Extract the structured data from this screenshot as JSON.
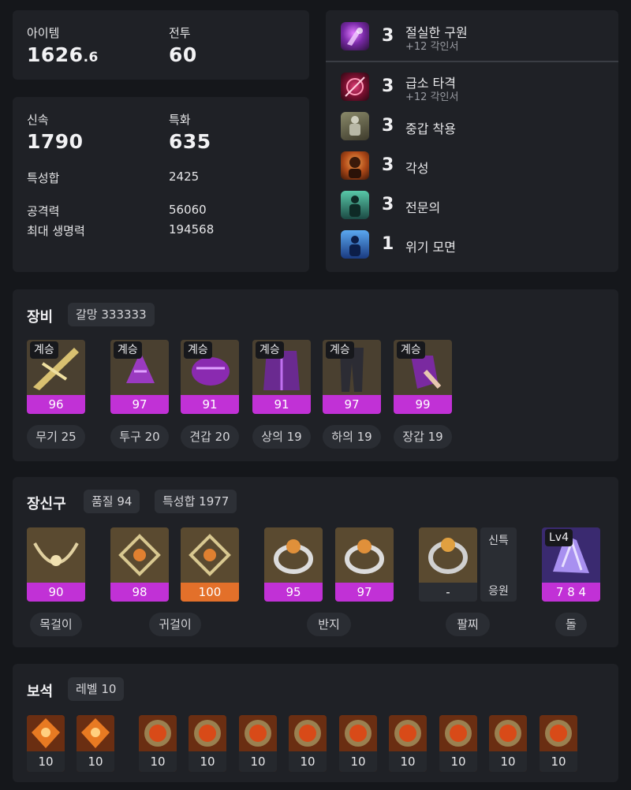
{
  "stats_top": {
    "item_label": "아이템",
    "item_value_main": "1626",
    "item_value_dec": ".6",
    "combat_label": "전투",
    "combat_value": "60"
  },
  "stats_detail": {
    "swift_label": "신속",
    "swift_value": "1790",
    "spec_label": "특화",
    "spec_value": "635",
    "trait_sum_label": "특성합",
    "trait_sum_value": "2425",
    "attack_label": "공격력",
    "attack_value": "56060",
    "hp_label": "최대 생명력",
    "hp_value": "194568"
  },
  "engravings": [
    {
      "level": "3",
      "name": "절실한 구원",
      "sub": "+12 각인서",
      "icon": "engraving-salvation-icon"
    },
    {
      "level": "3",
      "name": "급소 타격",
      "sub": "+12 각인서",
      "icon": "engraving-vital-strike-icon"
    },
    {
      "level": "3",
      "name": "중갑 착용",
      "sub": "",
      "icon": "engraving-heavy-armor-icon"
    },
    {
      "level": "3",
      "name": "각성",
      "sub": "",
      "icon": "engraving-awakening-icon"
    },
    {
      "level": "3",
      "name": "전문의",
      "sub": "",
      "icon": "engraving-specialist-icon"
    },
    {
      "level": "1",
      "name": "위기 모면",
      "sub": "",
      "icon": "engraving-crisis-evasion-icon"
    }
  ],
  "equipment": {
    "title": "장비",
    "chip": "갈망 333333",
    "items": [
      {
        "badge": "계승",
        "quality": "96",
        "label": "무기 25"
      },
      {
        "badge": "계승",
        "quality": "97",
        "label": "투구 20"
      },
      {
        "badge": "계승",
        "quality": "91",
        "label": "견갑 20"
      },
      {
        "badge": "계승",
        "quality": "91",
        "label": "상의 19"
      },
      {
        "badge": "계승",
        "quality": "97",
        "label": "하의 19"
      },
      {
        "badge": "계승",
        "quality": "99",
        "label": "장갑 19"
      }
    ]
  },
  "accessories": {
    "title": "장신구",
    "chip_quality": "품질 94",
    "chip_trait": "특성합 1977",
    "items": [
      {
        "quality": "90"
      },
      {
        "quality": "98"
      },
      {
        "quality": "100"
      },
      {
        "quality": "95"
      },
      {
        "quality": "97"
      },
      {
        "quality": "-"
      },
      {
        "quality": "7 8 4",
        "badge": "Lv4"
      }
    ],
    "bracelet_stats": [
      "신특",
      "응원"
    ],
    "labels": [
      "목걸이",
      "귀걸이",
      "반지",
      "팔찌",
      "돌"
    ]
  },
  "gems": {
    "title": "보석",
    "chip": "레벨 10",
    "levels": [
      "10",
      "10",
      "10",
      "10",
      "10",
      "10",
      "10",
      "10",
      "10",
      "10",
      "10"
    ]
  },
  "colors": {
    "quality_purple": "#c131d6",
    "quality_orange": "#e3702a",
    "panel": "#1f2126",
    "background": "#15171b"
  }
}
